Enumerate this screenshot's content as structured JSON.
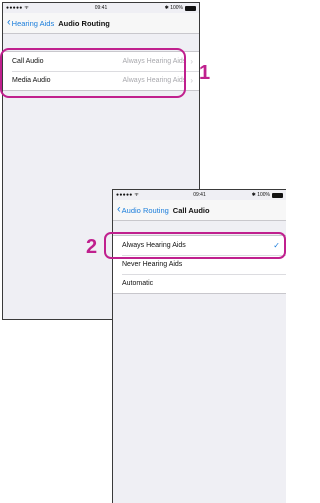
{
  "colors": {
    "accent": "#c0208e",
    "link": "#1a7ddb"
  },
  "screen1": {
    "status": {
      "signal": "●●●●● ᯤ",
      "time": "09:41",
      "battery": "✱ 100%"
    },
    "nav": {
      "back_label": "Hearing Aids",
      "title": "Audio Routing"
    },
    "rows": [
      {
        "label": "Call Audio",
        "value": "Always Hearing Aids"
      },
      {
        "label": "Media Audio",
        "value": "Always Hearing Aids"
      }
    ]
  },
  "screen2": {
    "status": {
      "signal": "●●●●● ᯤ",
      "time": "09:41",
      "battery": "✱ 100%"
    },
    "nav": {
      "back_label": "Audio Routing",
      "title": "Call Audio"
    },
    "options": [
      {
        "label": "Always Hearing Aids",
        "selected": true
      },
      {
        "label": "Never Hearing Aids",
        "selected": false
      },
      {
        "label": "Automatic",
        "selected": false
      }
    ]
  },
  "callouts": {
    "step1": "1",
    "step2": "2"
  }
}
